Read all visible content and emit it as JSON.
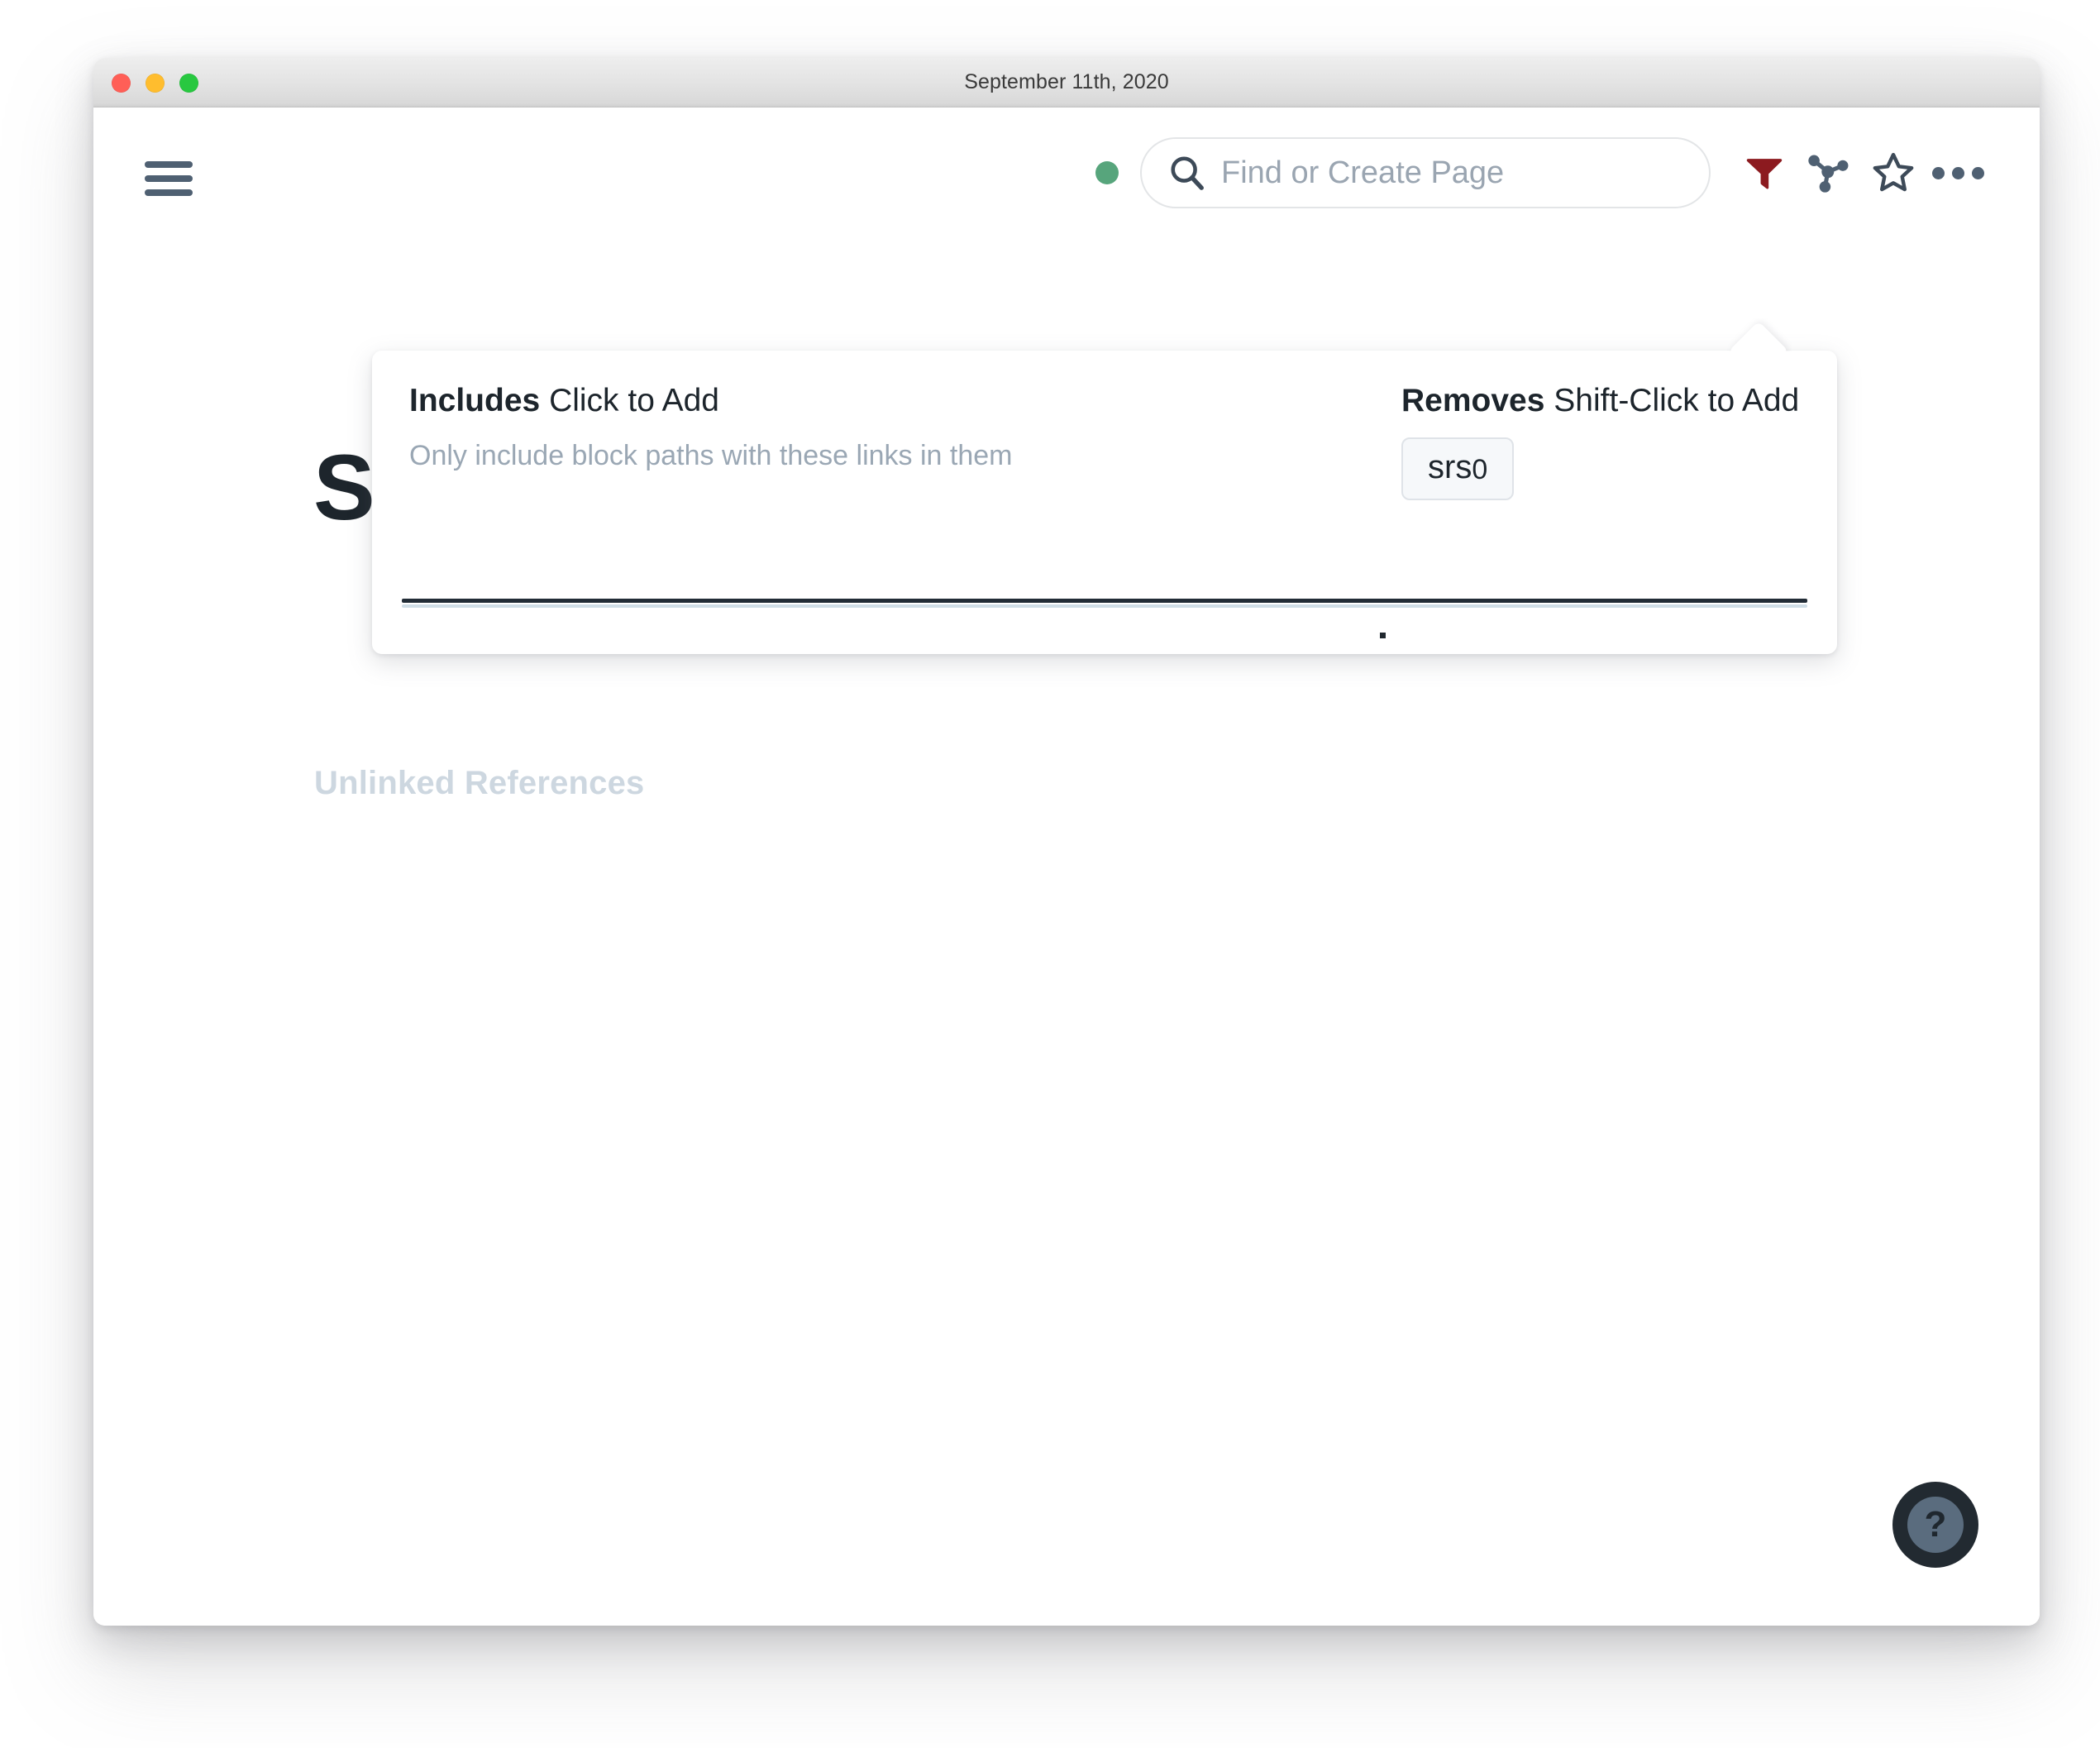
{
  "window": {
    "title": "September 11th, 2020",
    "traffic_lights": [
      "close",
      "minimize",
      "maximize"
    ]
  },
  "topbar": {
    "menu_icon": "hamburger-menu-icon",
    "status_dot": "online-status-dot",
    "status_color": "#57a57c",
    "search": {
      "value": "",
      "placeholder": "Find or Create Page",
      "icon": "search-icon"
    },
    "icons": [
      {
        "name": "filter-icon",
        "label": "Filter",
        "color": "#8c1a1f",
        "active": true
      },
      {
        "name": "graph-overview-icon",
        "label": "Graph Overview",
        "color": "#4f6072"
      },
      {
        "name": "star-icon",
        "label": "Favorite",
        "color": "#3d4a58"
      },
      {
        "name": "ellipsis-icon",
        "label": "More Options",
        "color": "#4f6072"
      }
    ]
  },
  "page": {
    "title": "S",
    "unlinked_references_label": "Unlinked References"
  },
  "filter_popover": {
    "includes": {
      "heading_bold": "Includes",
      "heading_rest": "Click to Add",
      "description": "Only include block paths with these links in them",
      "tags": []
    },
    "removes": {
      "heading_bold": "Removes",
      "heading_rest": "Shift-Click to Add",
      "tags": [
        {
          "label_main": "srs",
          "label_sub": "0"
        }
      ]
    }
  },
  "help": {
    "glyph": "?",
    "label": "Help"
  }
}
